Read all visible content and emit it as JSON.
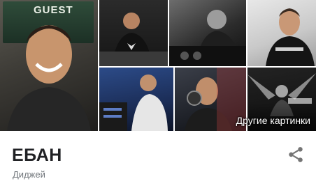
{
  "knowledge_panel": {
    "title": "ЕБАН",
    "subtitle": "Диджей",
    "more_images_label": "Другие картинки",
    "share_icon": "share-icon",
    "main_image_sign_text": "GUEST",
    "colors": {
      "title": "#202124",
      "subtitle": "#70757a",
      "share_icon": "#757575"
    }
  }
}
